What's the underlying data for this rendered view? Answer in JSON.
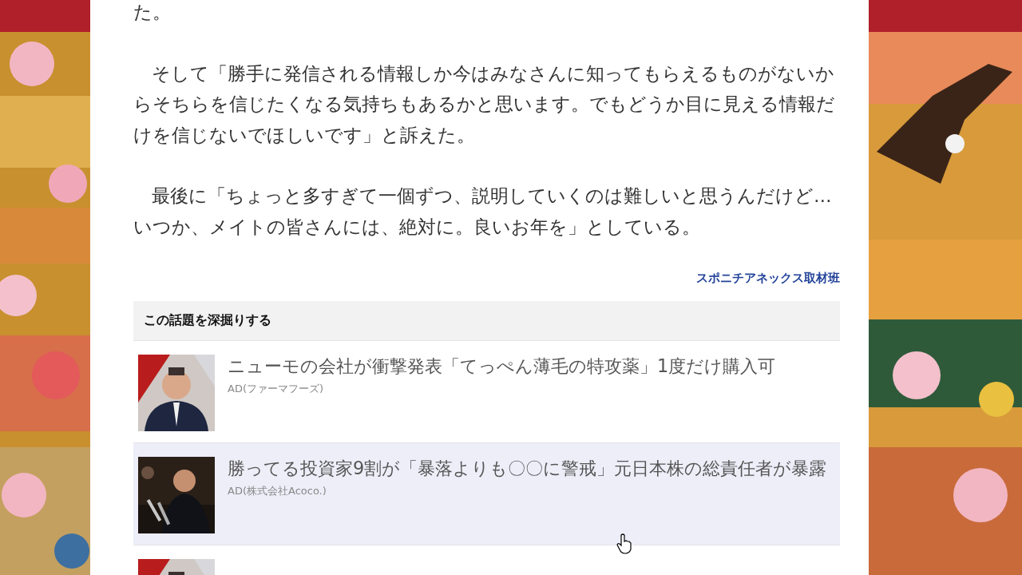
{
  "article": {
    "paragraphs": [
      "た。",
      "　そして「勝手に発信される情報しか今はみなさんに知ってもらえるものがないからそちらを信じたくなる気持ちもあるかと思います。でもどうか目に見える情報だけを信じないでほしいです」と訴えた。",
      "　最後に「ちょっと多すぎて一個ずつ、説明していくのは難しいと思うんだけど…いつか、メイトの皆さんには、絶対に。良いお年を」としている。"
    ],
    "credit": "スポニチアネックス取材班"
  },
  "related": {
    "heading": "この話題を深掘りする",
    "items": [
      {
        "title": "ニューモの会社が衝撃発表「てっぺん薄毛の特攻薬」1度だけ購入可",
        "source": "AD(ファーマフーズ)",
        "selected": false
      },
      {
        "title": "勝ってる投資家9割が「暴落よりも〇〇に警戒」元日本株の総責任者が暴露",
        "source": "AD(株式会社Acoco.)",
        "selected": true
      },
      {
        "selected": false
      }
    ]
  }
}
